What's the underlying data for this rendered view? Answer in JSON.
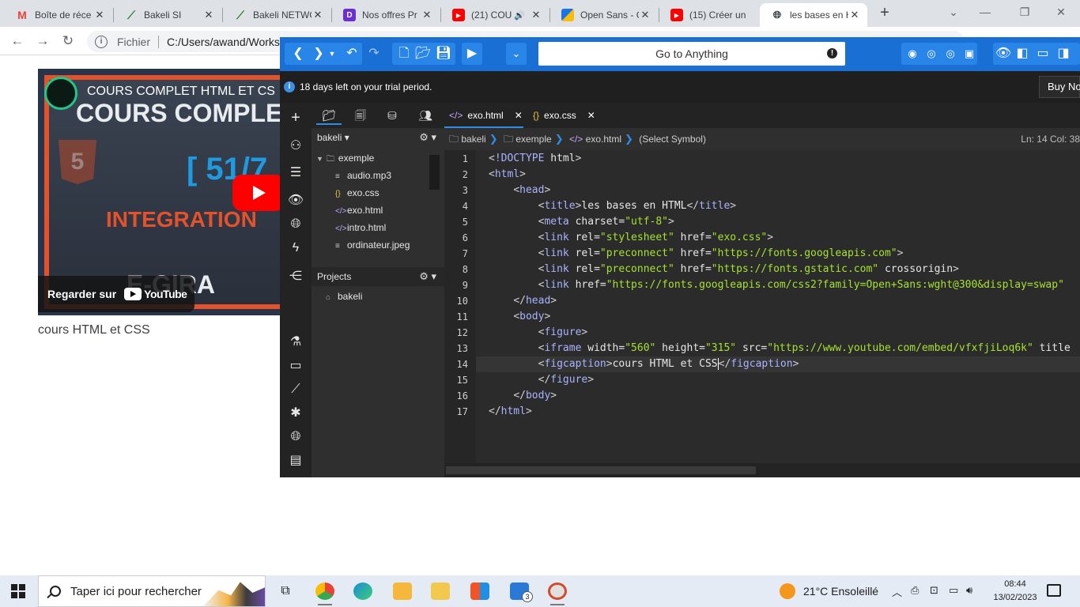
{
  "browser": {
    "tabs": [
      {
        "label": "Boîte de réce",
        "icon": "gmail-icon",
        "color": "#ea4335"
      },
      {
        "label": "Bakeli SI",
        "icon": "bakeli-icon",
        "color": "#2e7d32"
      },
      {
        "label": "Bakeli NETWO",
        "icon": "bakeli-icon",
        "color": "#2e7d32"
      },
      {
        "label": "Nos offres Pr",
        "icon": "offer-icon",
        "color": "#6c2cd6"
      },
      {
        "label": "(21) COU",
        "icon": "youtube-icon",
        "color": "#ff0000"
      },
      {
        "label": "Open Sans - G",
        "icon": "google-fonts-icon",
        "color": "#1a73e8"
      },
      {
        "label": "(15) Créer un",
        "icon": "youtube-icon",
        "color": "#ff0000"
      },
      {
        "label": "les bases en H",
        "icon": "globe-icon",
        "color": "#5f6368"
      }
    ],
    "address": {
      "scheme": "Fichier",
      "url": "C:/Users/awand/Workspa"
    }
  },
  "page": {
    "video": {
      "overlay_title": "COURS COMPLET HTML ET CS",
      "thumb_line1": "COURS COMPLET",
      "thumb_line2": "[ 51/7",
      "thumb_line3": "INTEGRATION",
      "thumb_line4": "E-GIRA",
      "watch_label": "Regarder sur",
      "youtube_word": "YouTube"
    },
    "caption": "cours HTML et CSS"
  },
  "editor": {
    "goto_placeholder": "Go to Anything",
    "trial_text": "18 days left on your trial period.",
    "buy_label": "Buy No",
    "project_name": "bakeli",
    "projects_label": "Projects",
    "folder": "exemple",
    "files": [
      "audio.mp3",
      "exo.css",
      "exo.html",
      "intro.html",
      "ordinateur.jpeg"
    ],
    "project_item": "bakeli",
    "tabs": [
      "exo.html",
      "exo.css"
    ],
    "breadcrumb": {
      "part1": "bakeli",
      "part2": "exemple",
      "part3": "exo.html",
      "part4": "(Select Symbol)"
    },
    "position": "Ln: 14 Col: 38",
    "code_lines": [
      "<!DOCTYPE html>",
      "<html>",
      "    <head>",
      "        <title>les bases en HTML</title>",
      "        <meta charset=\"utf-8\">",
      "        <link rel=\"stylesheet\" href=\"exo.css\">",
      "        <link rel=\"preconnect\" href=\"https://fonts.googleapis.com\">",
      "        <link rel=\"preconnect\" href=\"https://fonts.gstatic.com\" crossorigin>",
      "        <link href=\"https://fonts.googleapis.com/css2?family=Open+Sans:wght@300&display=swap\"",
      "    </head>",
      "    <body>",
      "        <figure>",
      "        <iframe width=\"560\" height=\"315\" src=\"https://www.youtube.com/embed/vfxfjiLoq6k\" title",
      "        <figcaption>cours HTML et CSS</figcaption>",
      "        </figure>",
      "    </body>",
      "</html>"
    ],
    "current_line": 14
  },
  "taskbar": {
    "search_placeholder": "Taper ici pour rechercher",
    "temperature": "21°C",
    "weather": "Ensoleillé",
    "time": "08:44",
    "date": "13/02/2023",
    "mail_badge": "3"
  }
}
